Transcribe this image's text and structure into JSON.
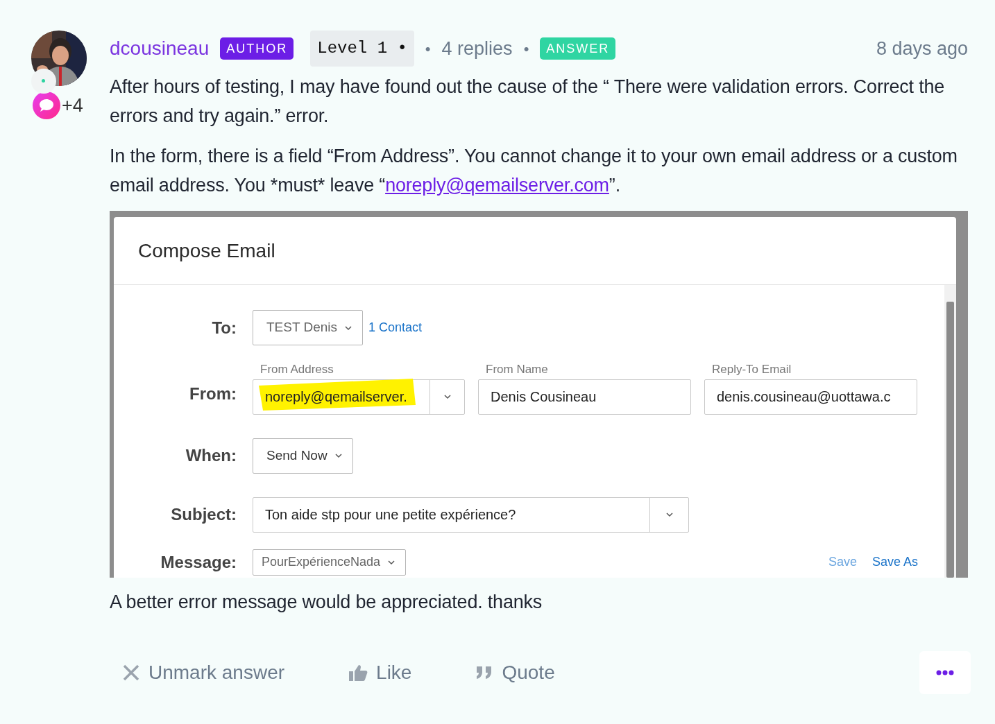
{
  "post": {
    "author": "dcousineau",
    "author_badge": "AUTHOR",
    "level": "Level 1 •",
    "separators": [
      "•",
      "•"
    ],
    "replies": "4 replies",
    "answer_badge": "ANSWER",
    "time": "8 days ago",
    "reaction_count": "+4",
    "paragraph_1": "After hours of testing, I may have found out the cause of the “ There were validation errors. Correct the errors and try again.” error.",
    "paragraph_2": {
      "before": "In the form, there is a field “From Address”. You cannot change it to your own email address or a custom email address. You *must* leave “",
      "link": "noreply@qemailserver.com",
      "after": "”."
    },
    "closing": "A better error message would be appreciated. thanks"
  },
  "screenshot": {
    "dialog_title": "Compose Email",
    "to": {
      "label": "To:",
      "value": "TEST Denis",
      "link": "1 Contact"
    },
    "from": {
      "label": "From:",
      "fields": [
        {
          "kind": "combo",
          "label": "From Address",
          "value": "noreply@qemailserver.",
          "highlighted": true
        },
        {
          "kind": "input",
          "label": "From Name",
          "value": "Denis Cousineau",
          "highlighted": false
        },
        {
          "kind": "input",
          "label": "Reply-To Email",
          "value": "denis.cousineau@uottawa.c",
          "highlighted": false
        }
      ]
    },
    "when": {
      "label": "When:",
      "value": "Send Now"
    },
    "subject": {
      "label": "Subject:",
      "value": "Ton aide stp pour une petite expérience?"
    },
    "message": {
      "label": "Message:",
      "value": "PourExpérienceNada",
      "links": [
        {
          "label": "Save",
          "disabled": true
        },
        {
          "label": "Save As",
          "disabled": false
        }
      ]
    }
  },
  "actions": [
    {
      "kind": "unmark",
      "label": "Unmark answer"
    },
    {
      "kind": "like",
      "label": "Like"
    },
    {
      "kind": "quote",
      "label": "Quote"
    },
    {
      "kind": "more"
    }
  ]
}
